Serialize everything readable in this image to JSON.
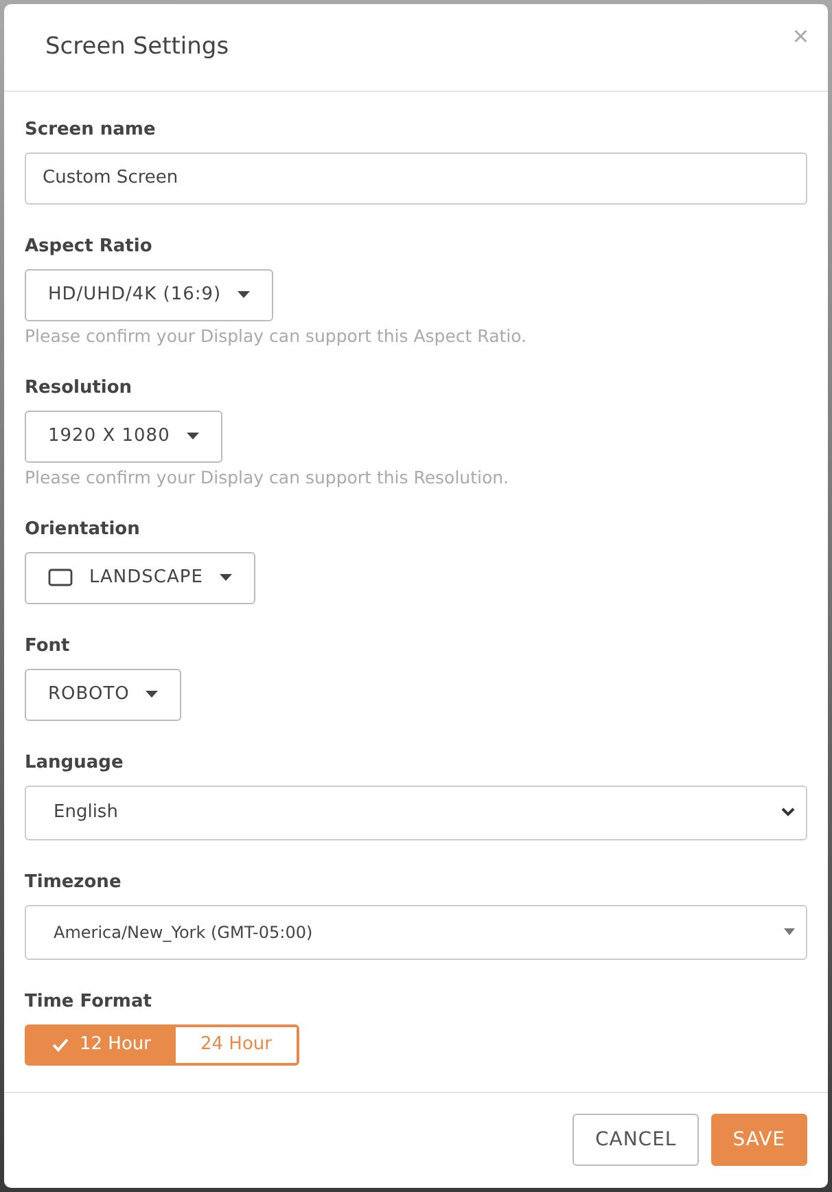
{
  "dialog": {
    "title": "Screen Settings",
    "close": "×"
  },
  "fields": [
    {
      "kind": "text",
      "label": "Screen name",
      "value": "Custom Screen"
    },
    {
      "kind": "dropdown",
      "label": "Aspect Ratio",
      "value": "HD/UHD/4K (16:9)",
      "help": "Please confirm your Display can support this Aspect Ratio."
    },
    {
      "kind": "dropdown",
      "label": "Resolution",
      "value": "1920 X 1080",
      "help": "Please confirm your Display can support this Resolution."
    },
    {
      "kind": "icon-dropdown",
      "label": "Orientation",
      "value": "LANDSCAPE"
    },
    {
      "kind": "dropdown",
      "label": "Font",
      "value": "ROBOTO"
    },
    {
      "kind": "select",
      "label": "Language",
      "value": "English"
    },
    {
      "kind": "combo",
      "label": "Timezone",
      "value": "America/New_York (GMT-05:00)"
    },
    {
      "kind": "toggle",
      "label": "Time Format",
      "options": [
        {
          "label": "12 Hour",
          "selected": true
        },
        {
          "label": "24 Hour",
          "selected": false
        }
      ]
    }
  ],
  "buttons": [
    {
      "label": "CANCEL",
      "kind": "secondary"
    },
    {
      "label": "SAVE",
      "kind": "primary"
    }
  ]
}
